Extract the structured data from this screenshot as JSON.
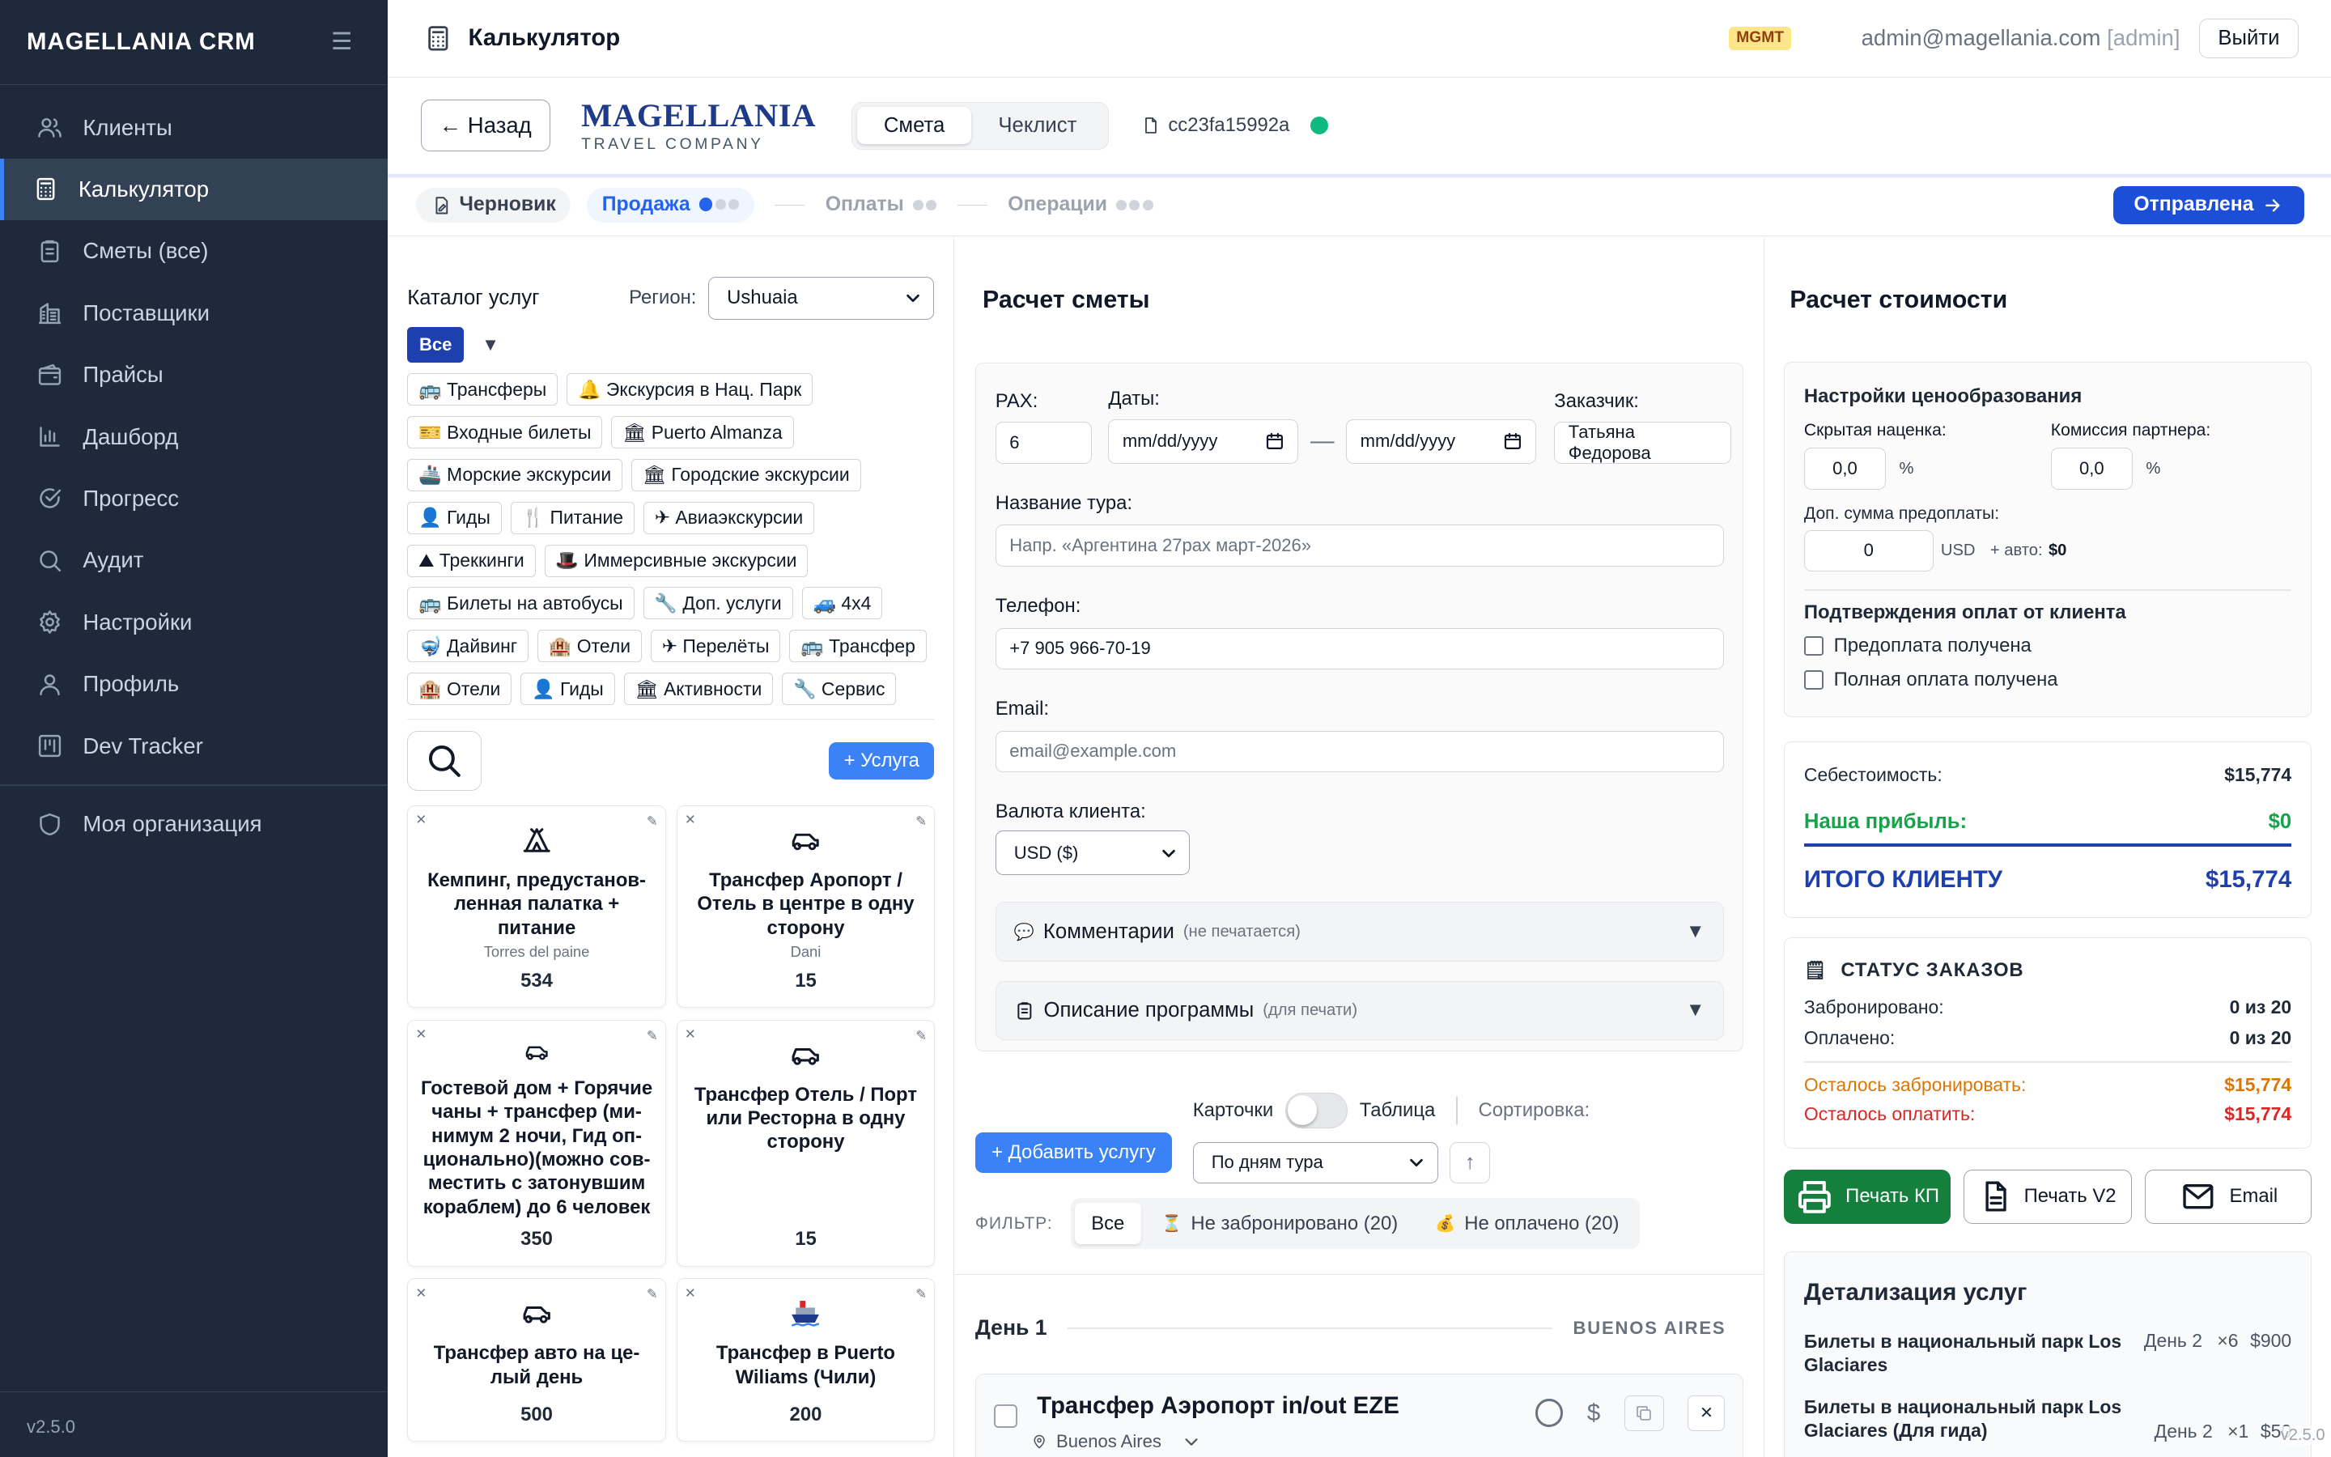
{
  "sidebar": {
    "brand": "MAGELLANIA CRM",
    "items": [
      {
        "label": "Клиенты",
        "icon": "users-icon"
      },
      {
        "label": "Калькулятор",
        "icon": "calculator-icon",
        "active": true
      },
      {
        "label": "Сметы (все)",
        "icon": "clipboard-icon"
      },
      {
        "label": "Поставщики",
        "icon": "building-icon"
      },
      {
        "label": "Прайсы",
        "icon": "wallet-icon"
      },
      {
        "label": "Дашборд",
        "icon": "bar-chart-icon"
      },
      {
        "label": "Прогресс",
        "icon": "check-circle-icon"
      },
      {
        "label": "Аудит",
        "icon": "search-icon"
      },
      {
        "label": "Настройки",
        "icon": "gear-icon"
      },
      {
        "label": "Профиль",
        "icon": "user-icon"
      },
      {
        "label": "Dev Tracker",
        "icon": "kanban-icon"
      }
    ],
    "org": "Моя организация",
    "version": "v2.5.0"
  },
  "topbar": {
    "title": "Калькулятор",
    "badge": "MGMT",
    "email": "admin@magellania.com",
    "role": "[admin]",
    "logout": "Выйти"
  },
  "header": {
    "back": "← Назад",
    "logo_main": "MAGELLANIA",
    "logo_sub": "TRAVEL COMPANY",
    "tabs": [
      "Смета",
      "Чеклист"
    ],
    "code": "cc23fa15992a"
  },
  "steps": {
    "draft": "Черновик",
    "sale": "Продажа",
    "payments": "Оплаты",
    "operations": "Операции",
    "sent": "Отправлена"
  },
  "catalog": {
    "title": "Каталог услуг",
    "region_label": "Регион:",
    "region": "Ushuaia",
    "all": "Все",
    "tags": [
      "🚌 Трансферы",
      "🔔 Экскурсия в Нац. Парк",
      "🎫 Входные билеты",
      "🏛 Puerto Almanza",
      "🚢 Морские экскурсии",
      "🏛 Городские экскурсии",
      "👤 Гиды",
      "🍴 Питание",
      "✈ Авиаэкскурсии",
      "⛰ Треккинги",
      "🎩 Иммерсивные экскурсии",
      "🚌 Билеты на автобусы",
      "🔧 Доп. услуги",
      "🚙 4x4",
      "🤿 Дайвинг",
      "🏨 Отели",
      "✈ Перелёты",
      "🚌 Трансфер",
      "🏨 Отели",
      "👤 Гиды",
      "🏛 Активности",
      "🔧 Сервис"
    ],
    "add": "+ Услуга",
    "cards": [
      {
        "name": "Кемпинг, предустанов-ленная палатка + питание",
        "sub": "Torres del paine",
        "num": "534",
        "icon": "tent-icon"
      },
      {
        "name": "Трансфер Аропорт / Отель в центре в одну сторону",
        "sub": "Dani",
        "num": "15",
        "icon": "car-icon"
      },
      {
        "name": "Гостевой дом + Горячие чаны + трансфер (ми-нимум 2 ночи, Гид оп-ционально)(можно сов-местить с затонувшим кораблем) до 6 человек",
        "sub": "",
        "num": "350",
        "icon": "car-icon"
      },
      {
        "name": "Трансфер Отель / Порт или Ресторна в одну сторону",
        "sub": "",
        "num": "15",
        "icon": "car-icon"
      },
      {
        "name": "Трансфер авто на це-лый день",
        "sub": "",
        "num": "500",
        "icon": "car-icon"
      },
      {
        "name": "Трансфер в Puerto Wiliams (Чили)",
        "sub": "",
        "num": "200",
        "icon": "ship-icon"
      }
    ]
  },
  "estimate": {
    "title": "Расчет сметы",
    "pax_label": "PAX:",
    "pax": "6",
    "dates_label": "Даты:",
    "date_ph": "mm/dd/yyyy",
    "dash": "—",
    "customer_label": "Заказчик:",
    "customer": "Татьяна Федорова",
    "tour_label": "Название тура:",
    "tour_ph": "Напр. «Аргентина 27pax март-2026»",
    "phone_label": "Телефон:",
    "phone": "+7 905 966-70-19",
    "email_label": "Email:",
    "email_ph": "email@example.com",
    "currency_label": "Валюта клиента:",
    "currency": "USD ($)",
    "comments": "Комментарии",
    "comments_note": "(не печатается)",
    "program": "Описание программы",
    "program_note": "(для печати)",
    "add_service": "+ Добавить услугу",
    "view_cards": "Карточки",
    "view_table": "Таблица",
    "sort_label": "Сортировка:",
    "sort": "По дням тура",
    "filter_label": "ФИЛЬТР:",
    "filter_all": "Все",
    "filter_unbooked": "Не забронировано (20)",
    "filter_unpaid": "Не оплачено (20)",
    "day_title": "День 1",
    "day_city": "BUENOS AIRES",
    "service_title": "Трансфер Аэропорт in/out EZE",
    "service_city": "Buenos Aires"
  },
  "pricing": {
    "title": "Расчет стоимости",
    "settings_title": "Настройки ценообразования",
    "hidden_markup_label": "Скрытая наценка:",
    "hidden_markup": "0,0",
    "partner_label": "Комиссия партнера:",
    "partner": "0,0",
    "pct": "%",
    "prepay_label": "Доп. сумма предоплаты:",
    "prepay": "0",
    "prepay_cur": "USD",
    "auto_label": "+ авто:",
    "auto_value": "$0",
    "confirm_title": "Подтверждения оплат от клиента",
    "prepaid": "Предоплата получена",
    "fullpaid": "Полная оплата получена",
    "cost_label": "Себестоимость:",
    "cost": "$15,774",
    "profit_label": "Наша прибыль:",
    "profit": "$0",
    "total_label": "ИТОГО КЛИЕНТУ",
    "total": "$15,774",
    "status_title": "СТАТУС ЗАКАЗОВ",
    "booked_label": "Забронировано:",
    "booked": "0 из 20",
    "paid_label": "Оплачено:",
    "paid": "0 из 20",
    "to_book_label": "Осталось забронировать:",
    "to_book": "$15,774",
    "to_pay_label": "Осталось оплатить:",
    "to_pay": "$15,774",
    "print_kp": "Печать КП",
    "print_v2": "Печать V2",
    "email_btn": "Email",
    "details_title": "Детализация услуг",
    "details": [
      {
        "name": "Билеты в национальный парк Los Glaciares",
        "day": "День 2",
        "qty": "×6",
        "price": "$900"
      },
      {
        "name": "Билеты в национальный парк Los Glaciares (Для гида)",
        "day": "День 2",
        "qty": "×1",
        "price": "$50"
      }
    ],
    "version": "v2.5.0"
  },
  "colors": {
    "sidebar": "#1e293b",
    "accent": "#3b82f6",
    "profit": "#16a34a",
    "total": "#1e40af",
    "warn": "#d97706",
    "danger": "#dc2626",
    "print": "#15803d"
  }
}
